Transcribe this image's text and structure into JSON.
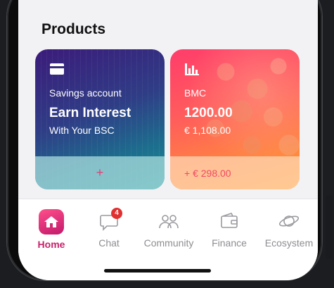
{
  "section": {
    "title": "Products"
  },
  "cards": [
    {
      "icon": "credit-card-icon",
      "label": "Savings account",
      "value": "Earn Interest",
      "sub": "With Your BSC",
      "footer": "+"
    },
    {
      "icon": "bar-chart-icon",
      "label": "BMC",
      "value": "1200.00",
      "sub": "€ 1,108.00",
      "footer": "+ € 298.00"
    }
  ],
  "tabs": [
    {
      "label": "Home",
      "icon": "home-icon",
      "active": true
    },
    {
      "label": "Chat",
      "icon": "chat-icon",
      "badge": "4"
    },
    {
      "label": "Community",
      "icon": "people-icon"
    },
    {
      "label": "Finance",
      "icon": "wallet-icon"
    },
    {
      "label": "Ecosystem",
      "icon": "planet-icon"
    }
  ],
  "colors": {
    "accent": "#c7236a",
    "badge": "#e03030",
    "inactive": "#8e8e93"
  }
}
